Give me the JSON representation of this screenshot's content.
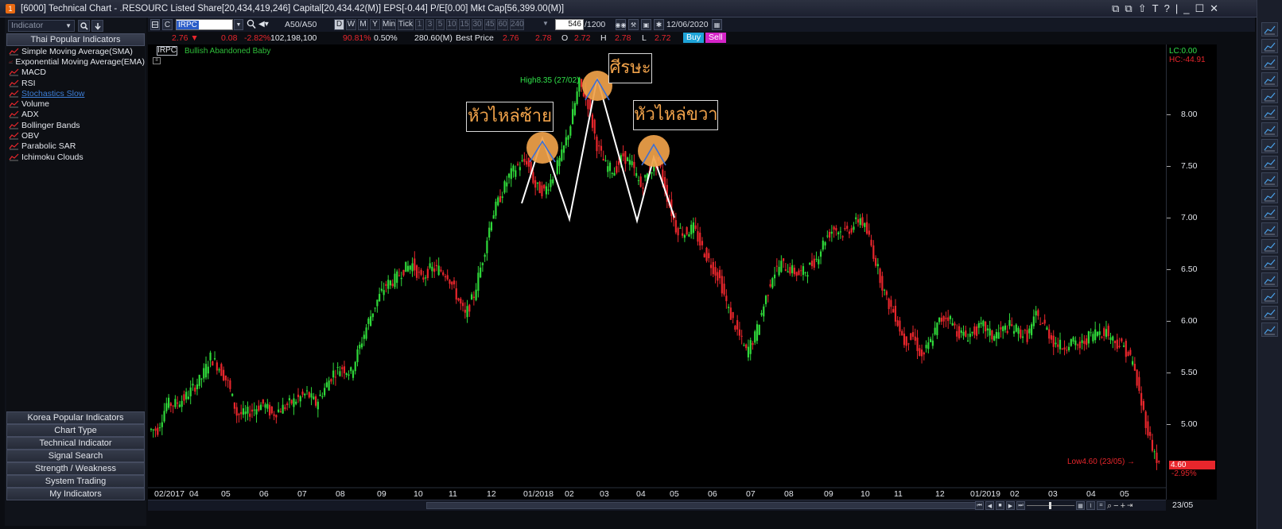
{
  "window": {
    "title": "[6000] Technical Chart - .RESOURC Listed Share[20,434,419,246] Capital[20,434.42(M)] EPS[-0.44] P/E[0.00] Mkt Cap[56,399.00(M)]",
    "controls": [
      "⧉",
      "⧉",
      "⇧",
      "T",
      "?",
      "|",
      "_",
      "☐",
      "✕"
    ]
  },
  "left_panel": {
    "selector_placeholder": "Indicator",
    "group_title": "Thai Popular Indicators",
    "indicators": [
      {
        "label": "Simple Moving Average(SMA)"
      },
      {
        "label": "Exponential Moving Average(EMA)"
      },
      {
        "label": "MACD"
      },
      {
        "label": "RSI"
      },
      {
        "label": "Stochastics Slow"
      },
      {
        "label": "Volume"
      },
      {
        "label": "ADX"
      },
      {
        "label": "Bollinger Bands"
      },
      {
        "label": "OBV"
      },
      {
        "label": "Parabolic SAR"
      },
      {
        "label": "Ichimoku Clouds"
      }
    ],
    "groups": [
      "Korea Popular Indicators",
      "Chart Type",
      "Technical Indicator",
      "Signal Search",
      "Strength / Weakness",
      "System Trading",
      "My Indicators"
    ]
  },
  "toolbar": {
    "c_label": "C",
    "symbol": "IRPC",
    "index_label": "A50/A50",
    "periods": [
      "D",
      "W",
      "M",
      "Y",
      "Min",
      "Tick",
      "1",
      "3",
      "5",
      "10",
      "15",
      "30",
      "45",
      "60",
      "240"
    ],
    "active_period": "D",
    "count_value": "546",
    "count_total": "/1200",
    "date": "12/06/2020"
  },
  "quote": {
    "last": "2.76 ▼",
    "change": "0.08",
    "pct": "-2.82%",
    "volume": "102,198,100",
    "pct2": "90.81%",
    "pct3": "0.50%",
    "value": "280.60(M)",
    "best_price_label": "Best Price",
    "bid": "2.76",
    "ask": "2.78",
    "o_label": "O",
    "o": "2.72",
    "h_label": "H",
    "h": "2.78",
    "l_label": "L",
    "l": "2.72",
    "buy": "Buy",
    "sell": "Sell"
  },
  "chart_labels": {
    "symbol_tag": "IRPC",
    "pattern": "Bullish Abandoned Baby",
    "lc": "LC:0.00",
    "hc": "HC:-44.91",
    "high_label": "High8.35 (27/02)",
    "low_label": "Low4.60 (23/05)",
    "last_tag": "4.60",
    "last_pct": "-2.95%",
    "note_left": "หัวไหล่ซ้าย",
    "note_head": "ศีรษะ",
    "note_right": "หัวไหล่ขวา"
  },
  "colors": {
    "up": "#2fd93a",
    "down": "#e8262c",
    "note_circle": "#f0a24a"
  },
  "chart_data": {
    "type": "candlestick",
    "y_ticks": [
      "8.00",
      "7.50",
      "7.00",
      "6.50",
      "6.00",
      "5.50",
      "5.00"
    ],
    "ylim": [
      4.45,
      8.55
    ],
    "x_labels": [
      "02/2017",
      "04",
      "05",
      "06",
      "07",
      "08",
      "09",
      "10",
      "11",
      "12",
      "01/2018",
      "02",
      "03",
      "04",
      "05",
      "06",
      "07",
      "08",
      "09",
      "10",
      "11",
      "12",
      "01/2019",
      "02",
      "03",
      "04",
      "05"
    ],
    "end_date": "23/05",
    "closes": [
      4.95,
      5.2,
      5.2,
      5.25,
      5.35,
      5.45,
      5.65,
      5.55,
      5.4,
      5.1,
      5.1,
      5.15,
      5.2,
      5.1,
      5.15,
      5.2,
      5.25,
      5.3,
      5.2,
      5.35,
      5.5,
      5.55,
      5.5,
      5.75,
      6.0,
      6.2,
      6.35,
      6.4,
      6.5,
      6.55,
      6.4,
      6.5,
      6.5,
      6.45,
      6.25,
      6.05,
      6.25,
      6.6,
      7.0,
      7.2,
      7.4,
      7.5,
      7.55,
      7.3,
      7.25,
      7.4,
      7.6,
      7.9,
      8.3,
      8.1,
      7.7,
      7.5,
      7.45,
      7.6,
      7.5,
      7.3,
      7.45,
      7.55,
      7.2,
      6.9,
      6.85,
      6.9,
      6.7,
      6.55,
      6.4,
      6.1,
      5.9,
      5.7,
      5.85,
      6.15,
      6.45,
      6.55,
      6.5,
      6.45,
      6.5,
      6.6,
      6.8,
      6.9,
      6.85,
      6.9,
      7.0,
      6.8,
      6.5,
      6.2,
      6.05,
      5.8,
      5.85,
      5.65,
      5.8,
      6.0,
      6.05,
      5.9,
      5.85,
      5.9,
      5.95,
      5.85,
      5.9,
      5.95,
      5.9,
      5.85,
      6.05,
      5.95,
      5.8,
      5.75,
      5.8,
      5.75,
      5.85,
      5.9,
      5.9,
      5.8,
      5.75,
      5.6,
      5.2,
      4.85,
      4.6
    ]
  }
}
